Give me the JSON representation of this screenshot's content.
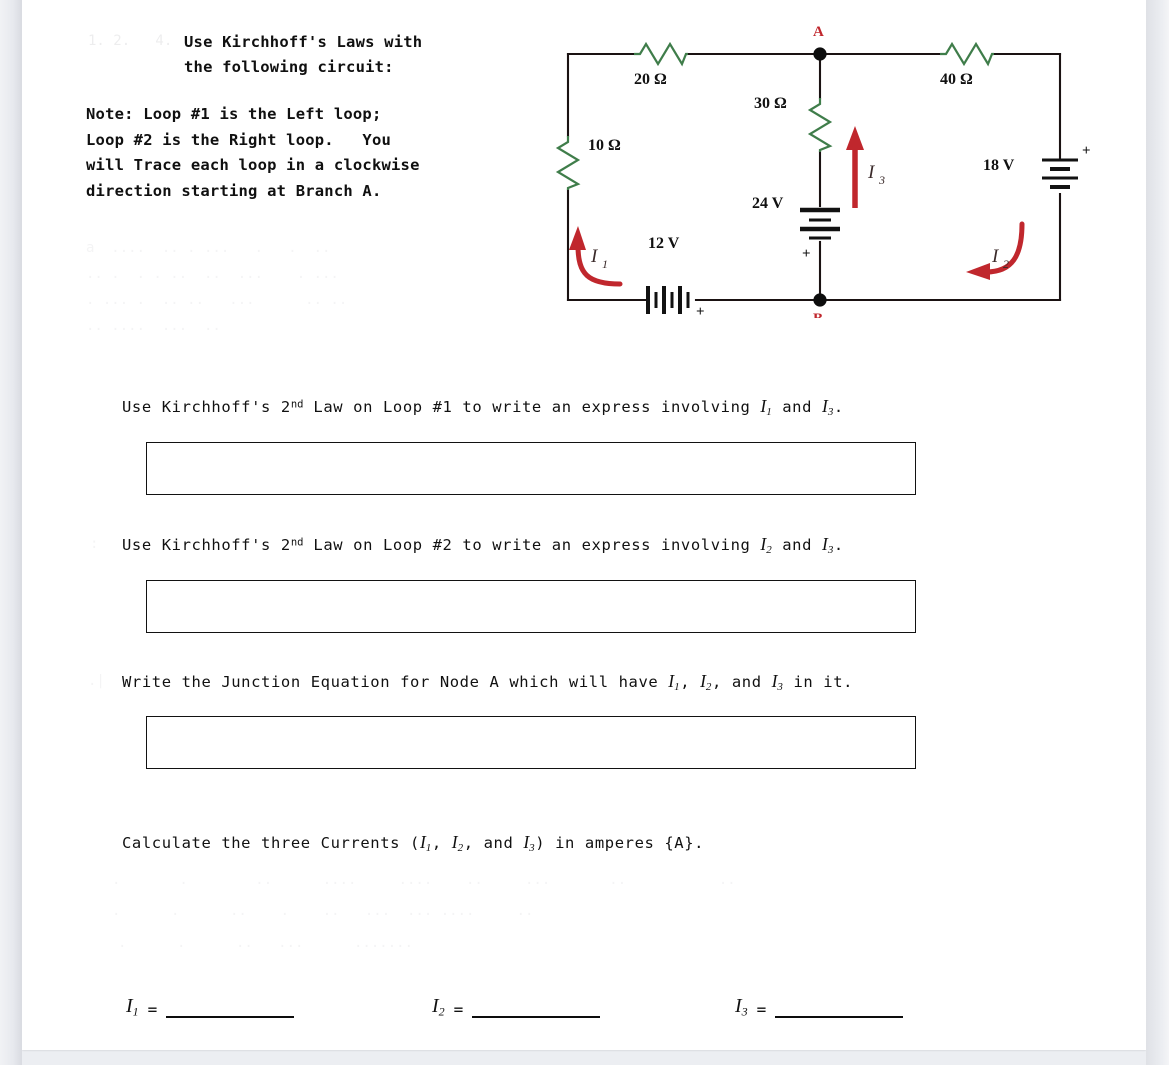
{
  "document": {
    "type": "physics-worksheet",
    "topic": "Kirchhoff's Laws"
  },
  "intro": {
    "heading_line1": "Use Kirchhoff's Laws with",
    "heading_line2": "the following circuit:",
    "note_line1": "Note: Loop #1 is the Left loop;",
    "note_line2": "Loop #2 is the Right loop.   You",
    "note_line3": "will Trace each loop in a clockwise",
    "note_line4": "direction starting at Branch A."
  },
  "circuit": {
    "title": "two-loop-dc-circuit",
    "nodes": [
      {
        "label": "A",
        "position": "top-middle",
        "color": "#c0272d"
      },
      {
        "label": "B",
        "position": "bottom-middle",
        "color": "#c0272d"
      }
    ],
    "resistors": [
      {
        "name": "r-20-ohm",
        "label": "20 Ω",
        "value": 20,
        "unit": "Ω",
        "branch": "top-left",
        "orientation": "horizontal"
      },
      {
        "name": "r-40-ohm",
        "label": "40 Ω",
        "value": 40,
        "unit": "Ω",
        "branch": "top-right",
        "orientation": "horizontal"
      },
      {
        "name": "r-10-ohm",
        "label": "10 Ω",
        "value": 10,
        "unit": "Ω",
        "branch": "left-side",
        "orientation": "vertical"
      },
      {
        "name": "r-30-ohm",
        "label": "30 Ω",
        "value": 30,
        "unit": "Ω",
        "branch": "middle",
        "orientation": "vertical"
      }
    ],
    "batteries": [
      {
        "name": "battery-12v",
        "label": "12 V",
        "value": 12,
        "unit": "V",
        "branch": "bottom-left",
        "orientation": "horizontal",
        "polarity_marker": "+",
        "polarity_side": "right"
      },
      {
        "name": "battery-24v",
        "label": "24 V",
        "value": 24,
        "unit": "V",
        "branch": "middle",
        "orientation": "vertical",
        "polarity_marker": "+",
        "polarity_side": "bottom"
      },
      {
        "name": "battery-18v",
        "label": "18 V",
        "value": 18,
        "unit": "V",
        "branch": "right-side",
        "orientation": "vertical",
        "polarity_marker": "+",
        "polarity_side": "top"
      }
    ],
    "currents": [
      {
        "name": "current-i1",
        "label": "I",
        "subscript": "1",
        "loop": "left",
        "arrow": "curved-up-left",
        "color": "#c0272d"
      },
      {
        "name": "current-i2",
        "label": "I",
        "subscript": "2",
        "loop": "right",
        "arrow": "curved-down-left",
        "color": "#c0272d"
      },
      {
        "name": "current-i3",
        "label": "I",
        "subscript": "3",
        "loop": "middle-branch",
        "arrow": "straight-up",
        "color": "#c0272d"
      }
    ],
    "colors": {
      "wire": "#1a1212",
      "resistor": "#3f7d4a",
      "node": "#0d0d0d",
      "current": "#c0272d",
      "node_label": "#c0272d"
    }
  },
  "questions": [
    {
      "id": "q1",
      "prefix": "Use Kirchhoff's 2",
      "sup": "nd",
      "mid": " Law on Loop #1 to write an express involving ",
      "var1": "I",
      "var1sub": "1",
      "conj": " and ",
      "var2": "I",
      "var2sub": "3",
      "suffix": ".",
      "answer": ""
    },
    {
      "id": "q2",
      "prefix": "Use Kirchhoff's 2",
      "sup": "nd",
      "mid": " Law on Loop #2 to write an express involving ",
      "var1": "I",
      "var1sub": "2",
      "conj": " and ",
      "var2": "I",
      "var2sub": "3",
      "suffix": ".",
      "answer": ""
    },
    {
      "id": "q3",
      "prefix": "Write the Junction Equation for Node A which will have ",
      "sup": "",
      "mid": "",
      "var1": "I",
      "var1sub": "1",
      "conj": ",  ",
      "var2": "I",
      "var2sub": "2",
      "conj2": ",  and ",
      "var3": "I",
      "var3sub": "3",
      "suffix": " in it.",
      "answer": ""
    }
  ],
  "calculate": {
    "prefix": "Calculate the three Currents (",
    "var1": "I",
    "var1sub": "1",
    "sep1": ",  ",
    "var2": "I",
    "var2sub": "2",
    "sep2": ",  and ",
    "var3": "I",
    "var3sub": "3",
    "suffix": ") in amperes {A}."
  },
  "blanks": [
    {
      "name": "blank-i1",
      "label": "I",
      "sub": "1",
      "equals": "=",
      "value": ""
    },
    {
      "name": "blank-i2",
      "label": "I",
      "sub": "2",
      "equals": "=",
      "value": ""
    },
    {
      "name": "blank-i3",
      "label": "I",
      "sub": "3",
      "equals": "=",
      "value": ""
    }
  ]
}
